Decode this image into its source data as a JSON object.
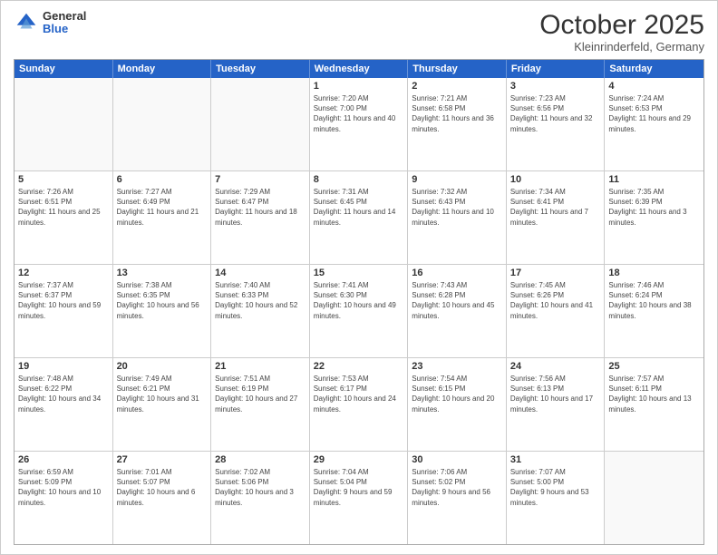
{
  "header": {
    "logo_general": "General",
    "logo_blue": "Blue",
    "month_title": "October 2025",
    "location": "Kleinrinderfeld, Germany"
  },
  "calendar": {
    "days_of_week": [
      "Sunday",
      "Monday",
      "Tuesday",
      "Wednesday",
      "Thursday",
      "Friday",
      "Saturday"
    ],
    "weeks": [
      [
        {
          "day": "",
          "empty": true
        },
        {
          "day": "",
          "empty": true
        },
        {
          "day": "",
          "empty": true
        },
        {
          "day": "1",
          "sunrise": "7:20 AM",
          "sunset": "7:00 PM",
          "daylight": "11 hours and 40 minutes."
        },
        {
          "day": "2",
          "sunrise": "7:21 AM",
          "sunset": "6:58 PM",
          "daylight": "11 hours and 36 minutes."
        },
        {
          "day": "3",
          "sunrise": "7:23 AM",
          "sunset": "6:56 PM",
          "daylight": "11 hours and 32 minutes."
        },
        {
          "day": "4",
          "sunrise": "7:24 AM",
          "sunset": "6:53 PM",
          "daylight": "11 hours and 29 minutes."
        }
      ],
      [
        {
          "day": "5",
          "sunrise": "7:26 AM",
          "sunset": "6:51 PM",
          "daylight": "11 hours and 25 minutes."
        },
        {
          "day": "6",
          "sunrise": "7:27 AM",
          "sunset": "6:49 PM",
          "daylight": "11 hours and 21 minutes."
        },
        {
          "day": "7",
          "sunrise": "7:29 AM",
          "sunset": "6:47 PM",
          "daylight": "11 hours and 18 minutes."
        },
        {
          "day": "8",
          "sunrise": "7:31 AM",
          "sunset": "6:45 PM",
          "daylight": "11 hours and 14 minutes."
        },
        {
          "day": "9",
          "sunrise": "7:32 AM",
          "sunset": "6:43 PM",
          "daylight": "11 hours and 10 minutes."
        },
        {
          "day": "10",
          "sunrise": "7:34 AM",
          "sunset": "6:41 PM",
          "daylight": "11 hours and 7 minutes."
        },
        {
          "day": "11",
          "sunrise": "7:35 AM",
          "sunset": "6:39 PM",
          "daylight": "11 hours and 3 minutes."
        }
      ],
      [
        {
          "day": "12",
          "sunrise": "7:37 AM",
          "sunset": "6:37 PM",
          "daylight": "10 hours and 59 minutes."
        },
        {
          "day": "13",
          "sunrise": "7:38 AM",
          "sunset": "6:35 PM",
          "daylight": "10 hours and 56 minutes."
        },
        {
          "day": "14",
          "sunrise": "7:40 AM",
          "sunset": "6:33 PM",
          "daylight": "10 hours and 52 minutes."
        },
        {
          "day": "15",
          "sunrise": "7:41 AM",
          "sunset": "6:30 PM",
          "daylight": "10 hours and 49 minutes."
        },
        {
          "day": "16",
          "sunrise": "7:43 AM",
          "sunset": "6:28 PM",
          "daylight": "10 hours and 45 minutes."
        },
        {
          "day": "17",
          "sunrise": "7:45 AM",
          "sunset": "6:26 PM",
          "daylight": "10 hours and 41 minutes."
        },
        {
          "day": "18",
          "sunrise": "7:46 AM",
          "sunset": "6:24 PM",
          "daylight": "10 hours and 38 minutes."
        }
      ],
      [
        {
          "day": "19",
          "sunrise": "7:48 AM",
          "sunset": "6:22 PM",
          "daylight": "10 hours and 34 minutes."
        },
        {
          "day": "20",
          "sunrise": "7:49 AM",
          "sunset": "6:21 PM",
          "daylight": "10 hours and 31 minutes."
        },
        {
          "day": "21",
          "sunrise": "7:51 AM",
          "sunset": "6:19 PM",
          "daylight": "10 hours and 27 minutes."
        },
        {
          "day": "22",
          "sunrise": "7:53 AM",
          "sunset": "6:17 PM",
          "daylight": "10 hours and 24 minutes."
        },
        {
          "day": "23",
          "sunrise": "7:54 AM",
          "sunset": "6:15 PM",
          "daylight": "10 hours and 20 minutes."
        },
        {
          "day": "24",
          "sunrise": "7:56 AM",
          "sunset": "6:13 PM",
          "daylight": "10 hours and 17 minutes."
        },
        {
          "day": "25",
          "sunrise": "7:57 AM",
          "sunset": "6:11 PM",
          "daylight": "10 hours and 13 minutes."
        }
      ],
      [
        {
          "day": "26",
          "sunrise": "6:59 AM",
          "sunset": "5:09 PM",
          "daylight": "10 hours and 10 minutes."
        },
        {
          "day": "27",
          "sunrise": "7:01 AM",
          "sunset": "5:07 PM",
          "daylight": "10 hours and 6 minutes."
        },
        {
          "day": "28",
          "sunrise": "7:02 AM",
          "sunset": "5:06 PM",
          "daylight": "10 hours and 3 minutes."
        },
        {
          "day": "29",
          "sunrise": "7:04 AM",
          "sunset": "5:04 PM",
          "daylight": "9 hours and 59 minutes."
        },
        {
          "day": "30",
          "sunrise": "7:06 AM",
          "sunset": "5:02 PM",
          "daylight": "9 hours and 56 minutes."
        },
        {
          "day": "31",
          "sunrise": "7:07 AM",
          "sunset": "5:00 PM",
          "daylight": "9 hours and 53 minutes."
        },
        {
          "day": "",
          "empty": true
        }
      ]
    ]
  }
}
